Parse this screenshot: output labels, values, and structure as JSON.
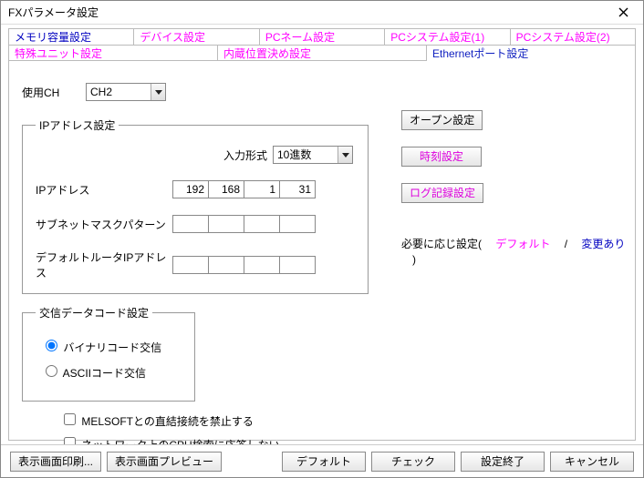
{
  "window": {
    "title": "FXパラメータ設定"
  },
  "tabs": {
    "row1": [
      {
        "label": "メモリ容量設定"
      },
      {
        "label": "デバイス設定"
      },
      {
        "label": "PCネーム設定"
      },
      {
        "label": "PCシステム設定(1)"
      },
      {
        "label": "PCシステム設定(2)"
      }
    ],
    "row2": [
      {
        "label": "特殊ユニット設定"
      },
      {
        "label": "内蔵位置決め設定"
      },
      {
        "label": "Ethernetポート設定"
      }
    ]
  },
  "use_ch": {
    "label": "使用CH",
    "value": "CH2"
  },
  "ip_group": {
    "legend": "IPアドレス設定",
    "input_format": {
      "label": "入力形式",
      "value": "10進数"
    },
    "ip": {
      "label": "IPアドレス",
      "oct1": "192",
      "oct2": "168",
      "oct3": "1",
      "oct4": "31"
    },
    "subnet": {
      "label": "サブネットマスクパターン",
      "oct1": "",
      "oct2": "",
      "oct3": "",
      "oct4": ""
    },
    "gateway": {
      "label": "デフォルトルータIPアドレス",
      "oct1": "",
      "oct2": "",
      "oct3": "",
      "oct4": ""
    }
  },
  "data_code_group": {
    "legend": "交信データコード設定",
    "binary": "バイナリコード交信",
    "ascii": "ASCIIコード交信"
  },
  "side": {
    "open": "オープン設定",
    "time": "時刻設定",
    "log": "ログ記録設定",
    "note_prefix": "必要に応じ設定(　",
    "note_default": "デフォルト",
    "note_sep": "　/　",
    "note_changed": "変更あり",
    "note_suffix": "　)"
  },
  "checks": {
    "melsoft": "MELSOFTとの直結接続を禁止する",
    "cpu_search": "ネットワーク上のCPU検索に応答しない"
  },
  "bottom": {
    "print": "表示画面印刷...",
    "preview": "表示画面プレビュー",
    "defaults": "デフォルト",
    "check": "チェック",
    "finish": "設定終了",
    "cancel": "キャンセル"
  }
}
